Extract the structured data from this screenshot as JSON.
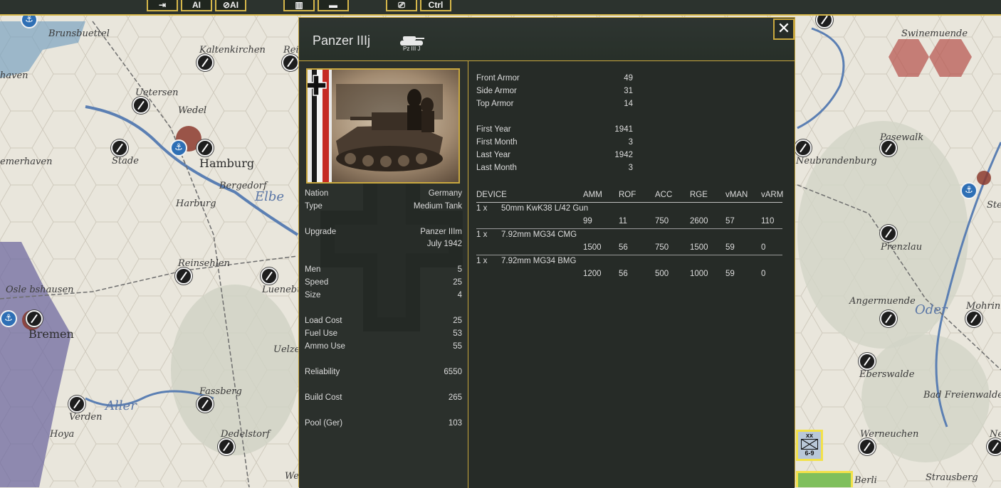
{
  "toolbar": {
    "buttons": [
      {
        "label": "⇥",
        "name": "next-unit-button"
      },
      {
        "label": "AI",
        "name": "ai-button"
      },
      {
        "label": "⊘AI",
        "name": "ai-off-button"
      },
      {
        "label": "▥",
        "name": "factory-button"
      },
      {
        "label": "▬",
        "name": "unit-list-button"
      },
      {
        "label": "⎚",
        "name": "report-button"
      },
      {
        "label": "Ctrl",
        "name": "ctrl-button"
      }
    ]
  },
  "map": {
    "labels": [
      {
        "text": "Brunsbuettel",
        "kind": "town"
      },
      {
        "text": "Kaltenkirchen",
        "kind": "town"
      },
      {
        "text": "Uetersen",
        "kind": "town"
      },
      {
        "text": "Wedel",
        "kind": "town"
      },
      {
        "text": "Hamburg",
        "kind": "city"
      },
      {
        "text": "Stade",
        "kind": "town"
      },
      {
        "text": "emerhaven",
        "kind": "town"
      },
      {
        "text": "Bergedorf",
        "kind": "town"
      },
      {
        "text": "Elbe",
        "kind": "river"
      },
      {
        "text": "Harburg",
        "kind": "town"
      },
      {
        "text": "Reinsehlen",
        "kind": "town"
      },
      {
        "text": "Osle bshausen",
        "kind": "town"
      },
      {
        "text": "Bremen",
        "kind": "city"
      },
      {
        "text": "Luenebu",
        "kind": "town"
      },
      {
        "text": "Uelze",
        "kind": "town"
      },
      {
        "text": "Fassberg",
        "kind": "town"
      },
      {
        "text": "Aller",
        "kind": "river"
      },
      {
        "text": "Verden",
        "kind": "town"
      },
      {
        "text": "Hoya",
        "kind": "town"
      },
      {
        "text": "Dedelstorf",
        "kind": "town"
      },
      {
        "text": "Swinemuende",
        "kind": "town"
      },
      {
        "text": "Pasewalk",
        "kind": "town"
      },
      {
        "text": "Neubrandenburg",
        "kind": "town"
      },
      {
        "text": "Prenzlau",
        "kind": "town"
      },
      {
        "text": "Angermuende",
        "kind": "town"
      },
      {
        "text": "Oder",
        "kind": "river"
      },
      {
        "text": "Mohrin",
        "kind": "town"
      },
      {
        "text": "Eberswalde",
        "kind": "town"
      },
      {
        "text": "Bad Freienwalde",
        "kind": "town"
      },
      {
        "text": "Werneuchen",
        "kind": "town"
      },
      {
        "text": "Strausberg",
        "kind": "town"
      },
      {
        "text": "Berli",
        "kind": "town"
      },
      {
        "text": "Ste",
        "kind": "town"
      },
      {
        "text": "haven",
        "kind": "town"
      },
      {
        "text": "Rei",
        "kind": "town"
      },
      {
        "text": "We",
        "kind": "town"
      },
      {
        "text": "Ne",
        "kind": "town"
      }
    ],
    "counters": [
      {
        "size": "xx",
        "strength": "6-9"
      }
    ],
    "colors": {
      "land": "#e9e6dc",
      "sea": "#7aa2c0",
      "german_hex": "#6f6aa0",
      "soviet_hex": "#b5504a",
      "river": "#5b7fb3"
    }
  },
  "panel": {
    "title": "Panzer IIIj",
    "unit_icon_label": "Pz III J",
    "close_label": "✕",
    "portrait_alt": "Panzer III tank photograph",
    "left_stats": [
      {
        "key": "Nation",
        "value": "Germany"
      },
      {
        "key": "Type",
        "value": "Medium Tank"
      },
      {
        "key": "Upgrade",
        "value": "Panzer IIIm"
      },
      {
        "key": "",
        "value": "July 1942"
      },
      {
        "key": "Men",
        "value": "5"
      },
      {
        "key": "Speed",
        "value": "25"
      },
      {
        "key": "Size",
        "value": "4"
      },
      {
        "key": "Load Cost",
        "value": "25"
      },
      {
        "key": "Fuel Use",
        "value": "53"
      },
      {
        "key": "Ammo Use",
        "value": "55"
      },
      {
        "key": "Reliability",
        "value": "6550"
      },
      {
        "key": "Build Cost",
        "value": "265"
      },
      {
        "key": "Pool (Ger)",
        "value": "103"
      }
    ],
    "armor": [
      {
        "key": "Front Armor",
        "value": "49"
      },
      {
        "key": "Side Armor",
        "value": "31"
      },
      {
        "key": "Top Armor",
        "value": "14"
      },
      {
        "key": "First Year",
        "value": "1941"
      },
      {
        "key": "First Month",
        "value": "3"
      },
      {
        "key": "Last Year",
        "value": "1942"
      },
      {
        "key": "Last Month",
        "value": "3"
      }
    ],
    "devices_header": {
      "device": "DEVICE",
      "amm": "AMM",
      "rof": "ROF",
      "acc": "ACC",
      "rge": "RGE",
      "vman": "vMAN",
      "varm": "vARM"
    },
    "devices": [
      {
        "qty": "1 x",
        "name": "50mm KwK38 L/42 Gun",
        "amm": "99",
        "rof": "11",
        "acc": "750",
        "rge": "2600",
        "vman": "57",
        "varm": "110"
      },
      {
        "qty": "1 x",
        "name": "7.92mm MG34 CMG",
        "amm": "1500",
        "rof": "56",
        "acc": "750",
        "rge": "1500",
        "vman": "59",
        "varm": "0"
      },
      {
        "qty": "1 x",
        "name": "7.92mm MG34 BMG",
        "amm": "1200",
        "rof": "56",
        "acc": "500",
        "rge": "1000",
        "vman": "59",
        "varm": "0"
      }
    ],
    "colors": {
      "border": "#c9a83f",
      "background": "#2a302c",
      "text": "#dcdcdc"
    }
  }
}
